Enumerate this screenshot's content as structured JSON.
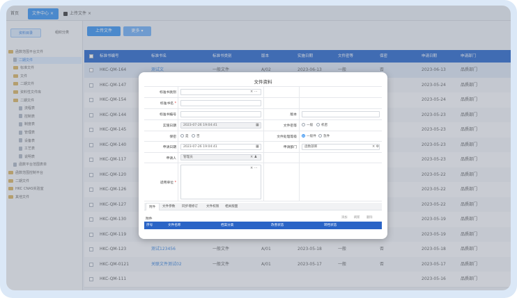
{
  "tabs": {
    "home": "首页",
    "center": "文件中心",
    "upload": "上传文件"
  },
  "sidebar": {
    "btn_a": "资料目录",
    "btn_b": "组织分类",
    "items": [
      {
        "label": "函数范围平台文件",
        "kind": "folder"
      },
      {
        "label": "二期文件",
        "kind": "doc",
        "selected": true
      },
      {
        "label": "标准文件",
        "kind": "folder"
      },
      {
        "label": "文件",
        "kind": "folder"
      },
      {
        "label": "二期文件",
        "kind": "folder"
      },
      {
        "label": "资料性文件库",
        "kind": "folder"
      },
      {
        "label": "二期文件",
        "kind": "folder"
      },
      {
        "label": "流程表",
        "kind": "doc"
      },
      {
        "label": "控制表",
        "kind": "doc"
      },
      {
        "label": "制度表",
        "kind": "doc"
      },
      {
        "label": "管理表",
        "kind": "doc"
      },
      {
        "label": "设备表",
        "kind": "doc"
      },
      {
        "label": "工艺表",
        "kind": "doc"
      },
      {
        "label": "说明表",
        "kind": "doc"
      },
      {
        "label": "函数平台范围表单",
        "kind": "doc"
      },
      {
        "label": "函数范围控制平台",
        "kind": "folder"
      },
      {
        "label": "二期文件",
        "kind": "folder"
      },
      {
        "label": "HKC CNAS实验室",
        "kind": "folder"
      },
      {
        "label": "其他文件",
        "kind": "folder"
      }
    ]
  },
  "toolbar": {
    "upload": "上传文件",
    "more": "更多 ▾"
  },
  "table": {
    "headers": [
      "标准书编号",
      "标准书名",
      "标准书类别",
      "版本",
      "实施日期",
      "文件密等",
      "保密",
      "申请日期",
      "申请部门"
    ],
    "rows": [
      [
        "HKC-QM-164",
        "测试文",
        "一般文件",
        "A/02",
        "2023-06-13",
        "一般",
        "否",
        "2023-06-13",
        "品质部门"
      ],
      [
        "HKC-QM-147",
        "",
        "",
        "",
        "",
        "",
        "",
        "2023-05-24",
        "品质部门"
      ],
      [
        "HKC-QM-154",
        "",
        "",
        "",
        "",
        "",
        "",
        "2023-05-24",
        "品质部门"
      ],
      [
        "HKC-QM-144",
        "",
        "",
        "",
        "",
        "",
        "",
        "2023-05-23",
        "品质部门"
      ],
      [
        "HKC-QM-145",
        "",
        "",
        "",
        "",
        "",
        "",
        "2023-05-23",
        "品质部门"
      ],
      [
        "HKC-QM-140",
        "",
        "",
        "",
        "",
        "",
        "",
        "2023-05-23",
        "品质部门"
      ],
      [
        "HKC-QM-117",
        "",
        "",
        "",
        "",
        "",
        "",
        "2023-05-23",
        "品质部门"
      ],
      [
        "HKC-QM-120",
        "",
        "",
        "",
        "",
        "",
        "",
        "2023-05-22",
        "品质部门"
      ],
      [
        "HKC-QM-126",
        "",
        "",
        "",
        "",
        "",
        "",
        "2023-05-22",
        "品质部门"
      ],
      [
        "HKC-QM-127",
        "",
        "",
        "",
        "",
        "",
        "",
        "2023-05-22",
        "品质部门"
      ],
      [
        "HKC-QM-130",
        "",
        "",
        "",
        "",
        "",
        "",
        "2023-05-19",
        "品质部门"
      ],
      [
        "HKC-QM-119",
        "",
        "",
        "",
        "",
        "",
        "",
        "2023-05-19",
        "品质部门"
      ],
      [
        "HKC-QM-123",
        "测试123456",
        "一般文件",
        "A/01",
        "2023-05-18",
        "一般",
        "否",
        "2023-05-18",
        "品质部门"
      ],
      [
        "HKC-QM-0121",
        "关联文件测试02",
        "一般文件",
        "A/01",
        "2023-05-17",
        "一般",
        "否",
        "2023-05-17",
        "品质部门"
      ],
      [
        "HKC-QM-111",
        "",
        "",
        "",
        "",
        "",
        "",
        "2023-05-16",
        "品质部门"
      ]
    ]
  },
  "modal": {
    "title": "文件资料",
    "labels": {
      "category": "标准书类别",
      "name": "标准书名",
      "number": "标准书编号",
      "version": "版本",
      "impl_date": "实施日期",
      "secret_level": "文件密等",
      "confidential": "保密",
      "handle_level": "文件处理等级",
      "apply_date": "申请日期",
      "apply_dept": "申请部门",
      "applicant": "申请人",
      "scope": "适用单位"
    },
    "values": {
      "impl_date": "2023-07-26 19:04:41",
      "apply_date": "2023-07-26 19:04:41",
      "applicant": "管理员",
      "apply_dept": "函数部库"
    },
    "radios": {
      "secret": [
        "一般",
        "机密"
      ],
      "confidential": [
        "是",
        "否"
      ],
      "handle": [
        "一般件",
        "急件"
      ]
    },
    "subtabs": [
      "附件",
      "文件参数",
      "同步增修订",
      "文件权限",
      "相关版面"
    ],
    "attach_label": "附件",
    "attach_buttons": [
      "添加",
      "刷新",
      "删除"
    ],
    "attach_headers": [
      "序号",
      "文件名称",
      "档案分类",
      "改善状态",
      "转档状态"
    ]
  }
}
